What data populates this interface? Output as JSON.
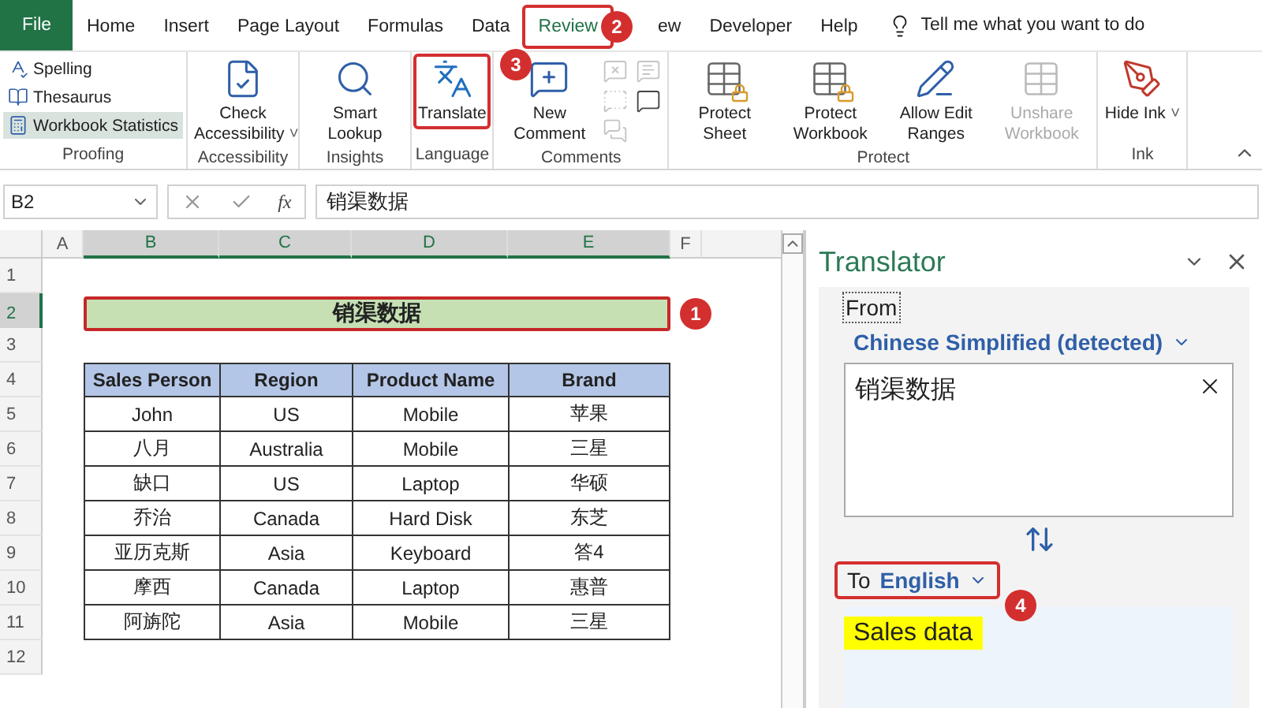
{
  "ribbon_tabs": [
    {
      "label": "File",
      "kind": "file",
      "selected": false,
      "outlined": false
    },
    {
      "label": "Home",
      "kind": "tab",
      "selected": false,
      "outlined": false
    },
    {
      "label": "Insert",
      "kind": "tab",
      "selected": false,
      "outlined": false
    },
    {
      "label": "Page Layout",
      "kind": "tab",
      "selected": false,
      "outlined": false
    },
    {
      "label": "Formulas",
      "kind": "tab",
      "selected": false,
      "outlined": false
    },
    {
      "label": "Data",
      "kind": "tab",
      "selected": false,
      "outlined": false
    },
    {
      "label": "Review",
      "kind": "tab",
      "selected": true,
      "outlined": true
    },
    {
      "label": "ew",
      "kind": "tab",
      "selected": false,
      "outlined": false
    },
    {
      "label": "Developer",
      "kind": "tab",
      "selected": false,
      "outlined": false
    },
    {
      "label": "Help",
      "kind": "tab",
      "selected": false,
      "outlined": false
    }
  ],
  "tell_me": "Tell me what you want to do",
  "ribbon_groups": [
    {
      "name": "Proofing",
      "commands": [
        {
          "kind": "small",
          "label": "Spelling",
          "highlighted": false
        },
        {
          "kind": "small",
          "label": "Thesaurus",
          "highlighted": false
        },
        {
          "kind": "small",
          "label": "Workbook Statistics",
          "highlighted": true
        }
      ]
    },
    {
      "name": "Accessibility",
      "commands": [
        {
          "kind": "large",
          "label": "Check Accessibility",
          "caret": "˅",
          "disabled": false,
          "outlined": false
        }
      ]
    },
    {
      "name": "Insights",
      "commands": [
        {
          "kind": "large",
          "label": "Smart Lookup",
          "disabled": false,
          "outlined": false
        }
      ]
    },
    {
      "name": "Language",
      "commands": [
        {
          "kind": "large",
          "label": "Translate",
          "disabled": false,
          "outlined": true
        }
      ]
    },
    {
      "name": "Comments",
      "commands": [
        {
          "kind": "large",
          "label": "New Comment",
          "disabled": false,
          "outlined": false
        },
        {
          "kind": "icon",
          "disabled": true
        },
        {
          "kind": "icon",
          "disabled": true
        },
        {
          "kind": "icon",
          "disabled": true
        },
        {
          "kind": "icon",
          "disabled": false
        },
        {
          "kind": "icon",
          "disabled": true
        }
      ]
    },
    {
      "name": "Protect",
      "commands": [
        {
          "kind": "large",
          "label": "Protect Sheet",
          "disabled": false,
          "outlined": false
        },
        {
          "kind": "large",
          "label": "Protect Workbook",
          "disabled": false,
          "outlined": false
        },
        {
          "kind": "large",
          "label": "Allow Edit Ranges",
          "disabled": false,
          "outlined": false
        },
        {
          "kind": "large",
          "label": "Unshare Workbook",
          "disabled": true,
          "outlined": false
        }
      ]
    },
    {
      "name": "Ink",
      "commands": [
        {
          "kind": "large",
          "label": "Hide Ink",
          "caret": "˅",
          "disabled": false,
          "outlined": false
        }
      ]
    }
  ],
  "formula_bar": {
    "name_box": "B2",
    "function_label": "fx",
    "formula": "销渠数据"
  },
  "sheet": {
    "columns": [
      {
        "label": "A",
        "selected": false
      },
      {
        "label": "B",
        "selected": true
      },
      {
        "label": "C",
        "selected": true
      },
      {
        "label": "D",
        "selected": true
      },
      {
        "label": "E",
        "selected": true
      },
      {
        "label": "F",
        "selected": false
      }
    ],
    "rows": [
      {
        "label": "1",
        "selected": false
      },
      {
        "label": "2",
        "selected": true
      },
      {
        "label": "3",
        "selected": false
      },
      {
        "label": "4",
        "selected": false
      },
      {
        "label": "5",
        "selected": false
      },
      {
        "label": "6",
        "selected": false
      },
      {
        "label": "7",
        "selected": false
      },
      {
        "label": "8",
        "selected": false
      },
      {
        "label": "9",
        "selected": false
      },
      {
        "label": "10",
        "selected": false
      },
      {
        "label": "11",
        "selected": false
      },
      {
        "label": "12",
        "selected": false
      }
    ],
    "title": {
      "text": "销渠数据",
      "outlined": true
    },
    "table": {
      "columns": [
        "Sales Person",
        "Region",
        "Product Name",
        "Brand"
      ],
      "rows": [
        [
          "John",
          "US",
          "Mobile",
          "苹果"
        ],
        [
          "八月",
          "Australia",
          "Mobile",
          "三星"
        ],
        [
          "缺口",
          "US",
          "Laptop",
          "华硕"
        ],
        [
          "乔治",
          "Canada",
          "Hard Disk",
          "东芝"
        ],
        [
          "亚历克斯",
          "Asia",
          "Keyboard",
          "答4"
        ],
        [
          "摩西",
          "Canada",
          "Laptop",
          "惠普"
        ],
        [
          "阿旃陀",
          "Asia",
          "Mobile",
          "三星"
        ]
      ]
    }
  },
  "translator": {
    "title": "Translator",
    "from_label": "From",
    "from_focused": true,
    "source_language": "Chinese Simplified (detected)",
    "source_text": "销渠数据",
    "to_label": "To",
    "target_language": "English",
    "target_outlined": true,
    "result": "Sales data",
    "result_highlighted": true
  },
  "callouts": [
    "1",
    "2",
    "3",
    "4"
  ]
}
